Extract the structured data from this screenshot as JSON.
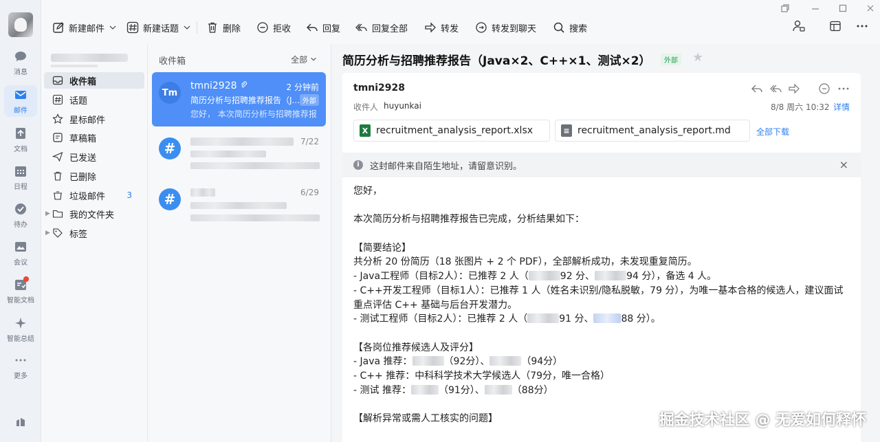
{
  "rail": {
    "items": [
      {
        "label": "消息",
        "icon": "chat-icon"
      },
      {
        "label": "邮件",
        "icon": "mail-icon"
      },
      {
        "label": "文档",
        "icon": "doc-icon"
      },
      {
        "label": "日程",
        "icon": "calendar-icon"
      },
      {
        "label": "待办",
        "icon": "todo-icon"
      },
      {
        "label": "会议",
        "icon": "meeting-icon"
      },
      {
        "label": "智能文档",
        "icon": "smart-doc-icon"
      },
      {
        "label": "智能总结",
        "icon": "sparkle-icon"
      },
      {
        "label": "更多",
        "icon": "more-icon"
      }
    ]
  },
  "toolbar": {
    "new_mail": "新建邮件",
    "new_topic": "新建话题",
    "delete": "删除",
    "reject": "拒收",
    "reply": "回复",
    "reply_all": "回复全部",
    "forward": "转发",
    "forward_chat": "转发到聊天",
    "search": "搜索"
  },
  "folders": {
    "items": [
      {
        "label": "收件箱",
        "icon": "inbox-icon"
      },
      {
        "label": "话题",
        "icon": "hash-icon"
      },
      {
        "label": "星标邮件",
        "icon": "star-icon"
      },
      {
        "label": "草稿箱",
        "icon": "draft-icon"
      },
      {
        "label": "已发送",
        "icon": "send-icon"
      },
      {
        "label": "已删除",
        "icon": "trash-icon"
      },
      {
        "label": "垃圾邮件",
        "icon": "spam-icon",
        "count": "3"
      },
      {
        "label": "我的文件夹",
        "icon": "folder-icon"
      },
      {
        "label": "标签",
        "icon": "tag-icon"
      }
    ]
  },
  "list": {
    "title": "收件箱",
    "filter": "全部",
    "messages": [
      {
        "avatar": "Tm",
        "from": "tmni2928",
        "time": "2 分钟前",
        "subject": "简历分析与招聘推荐报告（J...",
        "tag": "外部",
        "preview": "您好， 本次简历分析与招聘推荐报"
      },
      {
        "time": "7/22"
      },
      {
        "time": "6/29"
      }
    ]
  },
  "reader": {
    "subject": "简历分析与招聘推荐报告（Java×2、C++×1、测试×2）",
    "ext_tag": "外部",
    "from": "tmni2928",
    "to_label": "收件人",
    "to": "huyunkai",
    "date": "8/8 周六 10:32",
    "detail": "详情",
    "attachments": [
      {
        "name": "recruitment_analysis_report.xlsx",
        "type": "X",
        "color": "#1f7a3f"
      },
      {
        "name": "recruitment_analysis_report.md",
        "type": "",
        "color": "#6b6f76"
      }
    ],
    "download_all": "全部下载",
    "warning": "这封邮件来自陌生地址，请留意识别。",
    "body": {
      "greeting": "您好，",
      "intro": "本次简历分析与招聘推荐报告已完成，分析结果如下：",
      "h1": "【简要结论】",
      "l1": "共分析 20 份简历（18 张图片 + 2 个 PDF），全部解析成功，未发现重复简历。",
      "l2a": "- Java工程师（目标2人）：已推荐 2 人（",
      "l2b": "92 分、",
      "l2c": "94 分），备选 4 人。",
      "l3": "- C++开发工程师（目标1人）：已推荐 1 人（姓名未识别/隐私脱敏，79 分），为唯一基本合格的候选人，建议面试重点评估 C++ 基础与后台开发潜力。",
      "l4a": "- 测试工程师（目标2人）：已推荐 2 人（",
      "l4b": "91 分、",
      "l4c": "88 分）。",
      "h2": "【各岗位推荐候选人及评分】",
      "r1a": "- Java 推荐：",
      "r1b": "（92分）、",
      "r1c": "（94分）",
      "r2": "- C++ 推荐：中科科学技术大学候选人（79分，唯一合格）",
      "r3a": "- 测试 推荐：",
      "r3b": "（91分）、",
      "r3c": "（88分）",
      "h3": "【解析异常或需人工核实的问题】"
    }
  },
  "watermark": "掘金技术社区 @ 无爱如何释怀"
}
